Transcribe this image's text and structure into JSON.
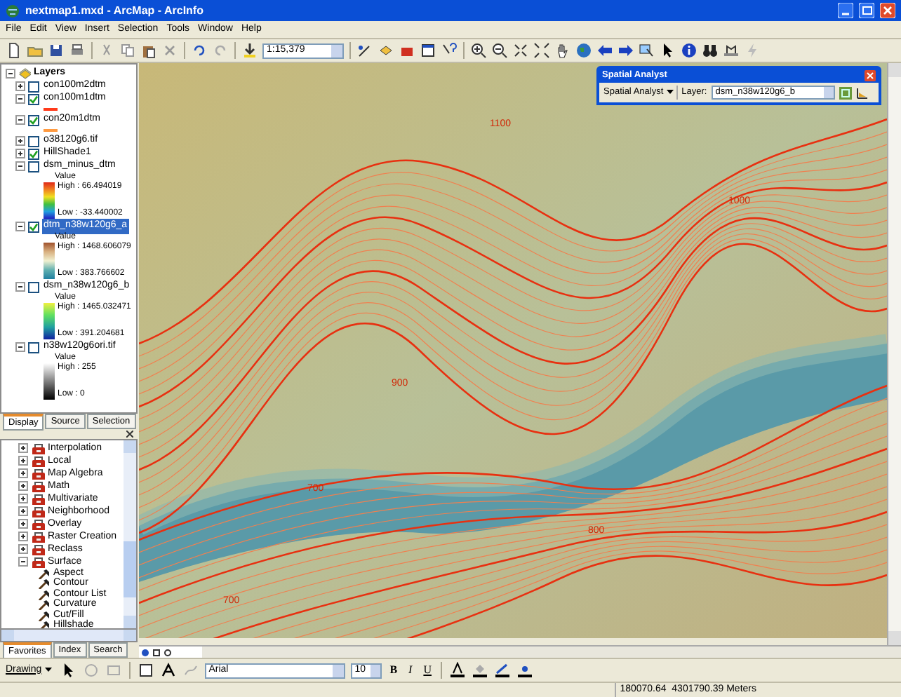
{
  "window": {
    "title": "nextmap1.mxd - ArcMap - ArcInfo"
  },
  "menu": [
    "File",
    "Edit",
    "View",
    "Insert",
    "Selection",
    "Tools",
    "Window",
    "Help"
  ],
  "toolbar": {
    "scale": "1:15,379"
  },
  "toc": {
    "root": "Layers",
    "layers": [
      {
        "name": "con100m2dtm",
        "checked": false,
        "expanded": false,
        "selected": false
      },
      {
        "name": "con100m1dtm",
        "checked": true,
        "expanded": true,
        "selected": false,
        "legend": {
          "kind": "line",
          "color": "#ff3a1a"
        }
      },
      {
        "name": "con20m1dtm",
        "checked": true,
        "expanded": true,
        "selected": false,
        "legend": {
          "kind": "line",
          "color": "#ff9a40"
        }
      },
      {
        "name": "o38120g6.tif",
        "checked": false,
        "expanded": false,
        "selected": false
      },
      {
        "name": "HillShade1",
        "checked": true,
        "expanded": false,
        "selected": false
      },
      {
        "name": "dsm_minus_dtm",
        "checked": false,
        "expanded": true,
        "selected": false,
        "legend": {
          "kind": "spectral",
          "title": "Value",
          "high": "High : 66.494019",
          "low": "Low : -33.440002"
        }
      },
      {
        "name": "dtm_n38w120g6_a",
        "checked": true,
        "expanded": true,
        "selected": true,
        "legend": {
          "kind": "terrain",
          "title": "Value",
          "high": "High : 1468.606079",
          "low": "Low : 383.766602"
        }
      },
      {
        "name": "dsm_n38w120g6_b",
        "checked": false,
        "expanded": true,
        "selected": false,
        "legend": {
          "kind": "yellowblue",
          "title": "Value",
          "high": "High : 1465.032471",
          "low": "Low : 391.204681"
        }
      },
      {
        "name": "n38w120g6ori.tif",
        "checked": false,
        "expanded": true,
        "selected": false,
        "legend": {
          "kind": "grayscale",
          "title": "Value",
          "high": "High : 255",
          "low": "Low : 0"
        }
      }
    ],
    "tabs": [
      {
        "label": "Display",
        "selected": true
      },
      {
        "label": "Source",
        "selected": false
      },
      {
        "label": "Selection",
        "selected": false
      }
    ]
  },
  "toolbox": {
    "items": [
      {
        "label": "Interpolation",
        "expanded": false
      },
      {
        "label": "Local",
        "expanded": false
      },
      {
        "label": "Map Algebra",
        "expanded": false
      },
      {
        "label": "Math",
        "expanded": false
      },
      {
        "label": "Multivariate",
        "expanded": false
      },
      {
        "label": "Neighborhood",
        "expanded": false
      },
      {
        "label": "Overlay",
        "expanded": false
      },
      {
        "label": "Raster Creation",
        "expanded": false
      },
      {
        "label": "Reclass",
        "expanded": false
      },
      {
        "label": "Surface",
        "expanded": true,
        "children": [
          "Aspect",
          "Contour",
          "Contour List",
          "Curvature",
          "Cut/Fill",
          "Hillshade"
        ]
      }
    ],
    "tabs": [
      {
        "label": "Favorites",
        "selected": true
      },
      {
        "label": "Index",
        "selected": false
      },
      {
        "label": "Search",
        "selected": false
      }
    ]
  },
  "map": {
    "contour_labels": [
      "1100",
      "1000",
      "900",
      "800",
      "700",
      "700"
    ]
  },
  "spatial_analyst": {
    "title": "Spatial Analyst",
    "menu": "Spatial Analyst",
    "layer_label": "Layer:",
    "layer_value": "dsm_n38w120g6_b"
  },
  "drawing_toolbar": {
    "menu": "Drawing",
    "font": "Arial",
    "size": "10",
    "bold": "B",
    "italic": "I",
    "underline": "U"
  },
  "status_bar": {
    "coordinates": "180070.64  4301790.39 Meters"
  }
}
